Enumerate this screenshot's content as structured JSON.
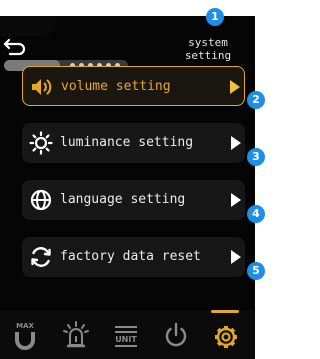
{
  "header": {
    "title_line1": "system",
    "title_line2": "setting",
    "back_icon": "back-arrow-icon",
    "progress": 0.45,
    "progress_dots": 6
  },
  "menu": [
    {
      "label": "volume setting",
      "icon": "speaker-icon",
      "badge": "2",
      "selected": true
    },
    {
      "label": "luminance setting",
      "icon": "sun-icon",
      "badge": "3",
      "selected": false
    },
    {
      "label": "language setting",
      "icon": "globe-icon",
      "badge": "4",
      "selected": false
    },
    {
      "label": "factory data reset",
      "icon": "refresh-icon",
      "badge": "5",
      "selected": false
    }
  ],
  "header_badge": "1",
  "tabs": [
    {
      "name": "max-tab",
      "label": "MAX",
      "icon": "max-magnet-icon"
    },
    {
      "name": "alarm-tab",
      "label": "",
      "icon": "alarm-icon"
    },
    {
      "name": "unit-tab",
      "label": "UNIT",
      "icon": "unit-icon"
    },
    {
      "name": "power-tab",
      "label": "",
      "icon": "power-icon"
    },
    {
      "name": "settings-tab",
      "label": "",
      "icon": "gear-icon",
      "active": true
    }
  ],
  "colors": {
    "accent": "#e3a720",
    "badge": "#1e8fe6",
    "background": "#050505",
    "item_bg": "#171717",
    "text": "#ececec",
    "icon_gray": "#8a8a8a"
  }
}
